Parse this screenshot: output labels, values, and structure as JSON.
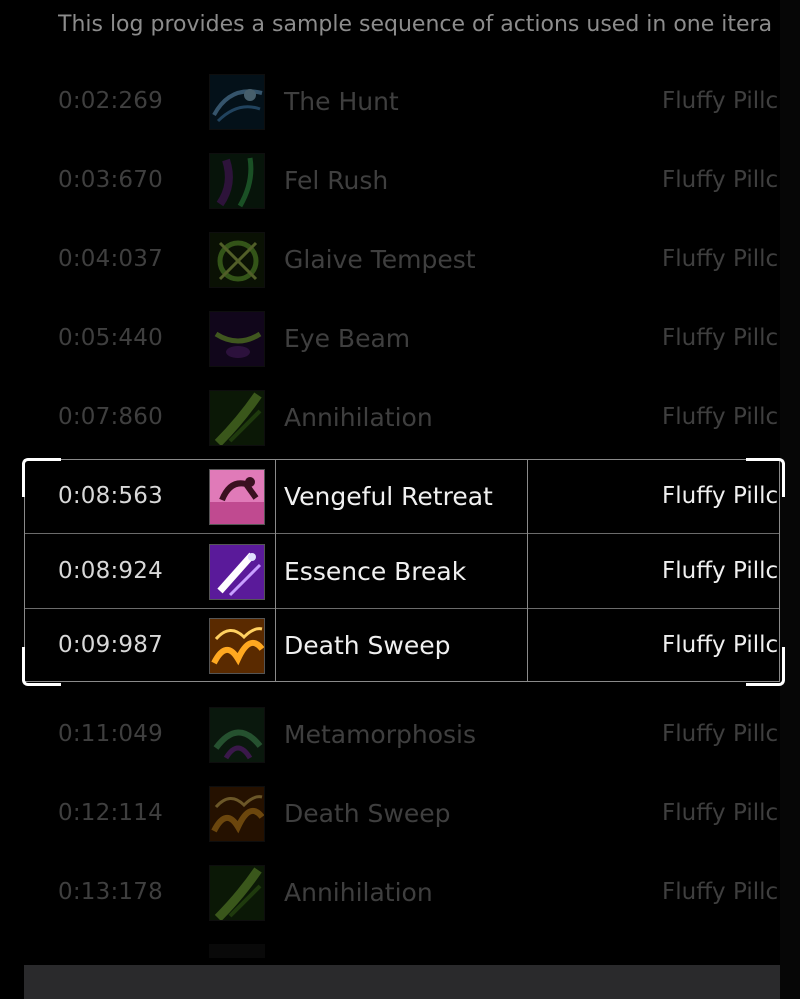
{
  "intro_text": "This log provides a sample sequence of actions used in one itera",
  "log": [
    {
      "time": "0:02:269",
      "spell": "The Hunt",
      "target": "Fluffy Pillc",
      "icon": "the-hunt-icon"
    },
    {
      "time": "0:03:670",
      "spell": "Fel Rush",
      "target": "Fluffy Pillc",
      "icon": "fel-rush-icon"
    },
    {
      "time": "0:04:037",
      "spell": "Glaive Tempest",
      "target": "Fluffy Pillc",
      "icon": "glaive-tempest-icon"
    },
    {
      "time": "0:05:440",
      "spell": "Eye Beam",
      "target": "Fluffy Pillc",
      "icon": "eye-beam-icon"
    },
    {
      "time": "0:07:860",
      "spell": "Annihilation",
      "target": "Fluffy Pillc",
      "icon": "annihilation-icon"
    },
    {
      "time": "0:08:563",
      "spell": "Vengeful Retreat",
      "target": "Fluffy Pillc",
      "icon": "vengeful-retreat-icon"
    },
    {
      "time": "0:08:924",
      "spell": "Essence Break",
      "target": "Fluffy Pillc",
      "icon": "essence-break-icon"
    },
    {
      "time": "0:09:987",
      "spell": "Death Sweep",
      "target": "Fluffy Pillc",
      "icon": "death-sweep-icon"
    },
    {
      "time": "0:11:049",
      "spell": "Metamorphosis",
      "target": "Fluffy Pillc",
      "icon": "metamorphosis-icon"
    },
    {
      "time": "0:12:114",
      "spell": "Death Sweep",
      "target": "Fluffy Pillc",
      "icon": "death-sweep-icon"
    },
    {
      "time": "0:13:178",
      "spell": "Annihilation",
      "target": "Fluffy Pillc",
      "icon": "annihilation-icon"
    }
  ],
  "colors": {
    "background": "#000000",
    "dimmed_text": "#3f3f3f",
    "highlight_text": "#f0f0f0",
    "selection_border": "#8a8a8a",
    "selection_corner": "#ffffff"
  }
}
